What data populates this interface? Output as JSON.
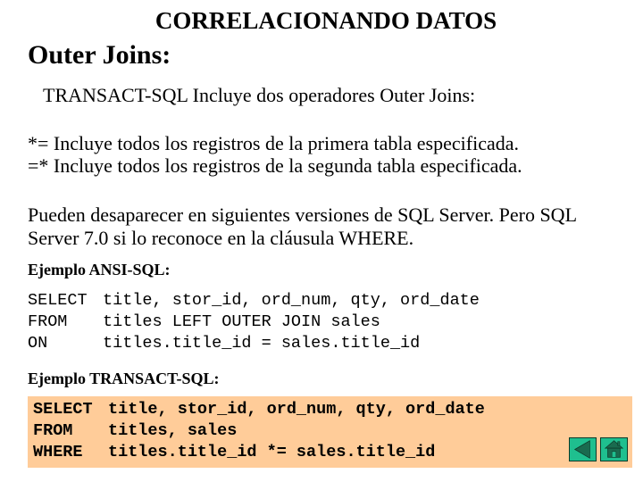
{
  "slide": {
    "title": "CORRELACIONANDO DATOS",
    "subtitle": "Outer Joins:",
    "intro": "TRANSACT-SQL Incluye dos operadores Outer Joins:",
    "operators": [
      "*= Incluye todos los registros de la primera tabla especificada.",
      "=* Incluye todos los registros de la segunda tabla especificada."
    ],
    "note_lines": [
      "Pueden desaparecer en siguientes versiones de SQL Server. Pero SQL",
      "Server 7.0 si lo reconoce en la cláusula WHERE."
    ],
    "ansi_example": {
      "label": "Ejemplo ANSI-SQL:",
      "lines": [
        {
          "keyword": "SELECT",
          "rest": "title, stor_id, ord_num, qty, ord_date"
        },
        {
          "keyword": "FROM",
          "rest": "titles LEFT OUTER JOIN sales"
        },
        {
          "keyword": "ON",
          "rest": "titles.title_id = sales.title_id"
        }
      ]
    },
    "tsql_example": {
      "label": "Ejemplo TRANSACT-SQL:",
      "background": "#ffcc99",
      "lines": [
        {
          "keyword": "SELECT",
          "rest": "title, stor_id, ord_num, qty, ord_date"
        },
        {
          "keyword": "FROM",
          "rest": "titles, sales"
        },
        {
          "keyword": "WHERE",
          "rest": "titles.title_id *= sales.title_id"
        }
      ]
    },
    "navigation": {
      "back_icon": "back-triangle-icon",
      "home_icon": "home-icon",
      "button_color": "#1fbf8f",
      "icon_color": "#1a6b4f"
    }
  }
}
